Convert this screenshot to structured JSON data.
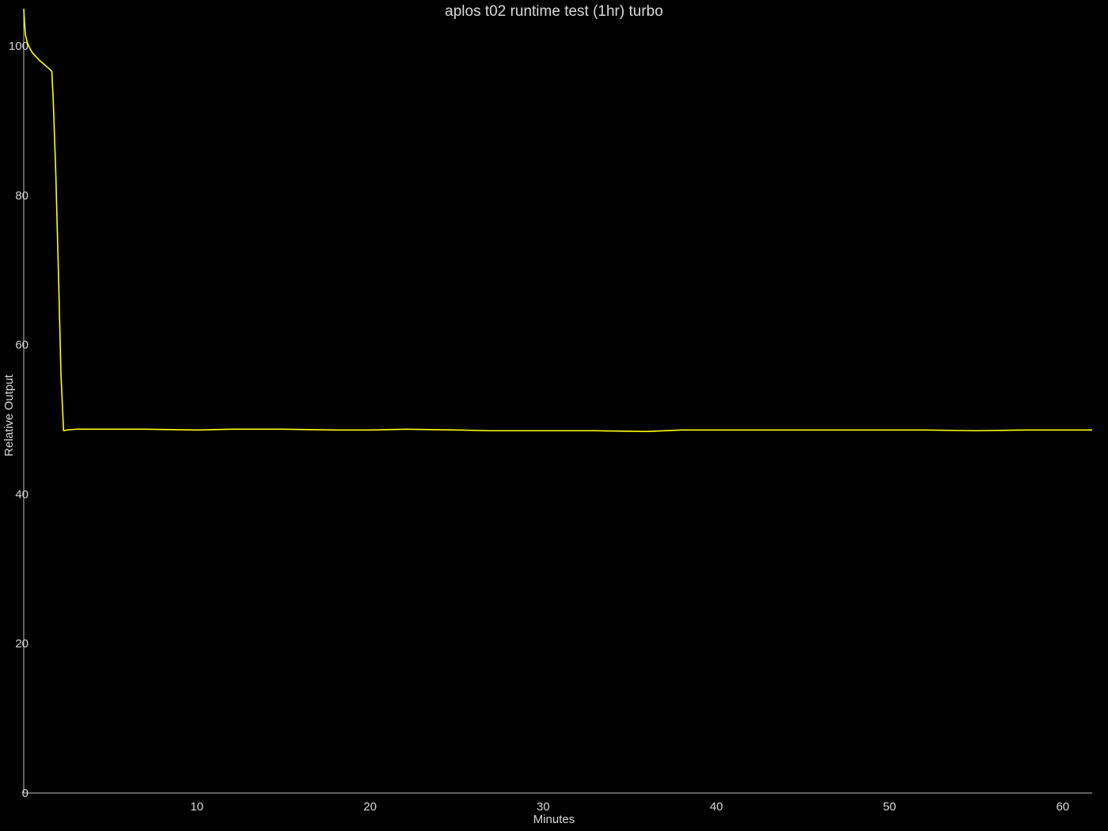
{
  "chart_data": {
    "type": "line",
    "title": "aplos t02 runtime test (1hr) turbo",
    "xlabel": "Minutes",
    "ylabel": "Relative Output",
    "xlim": [
      0,
      61.7
    ],
    "ylim": [
      0,
      105
    ],
    "x_ticks": [
      10,
      20,
      30,
      40,
      50,
      60
    ],
    "y_ticks": [
      0,
      20,
      40,
      60,
      80,
      100
    ],
    "grid": false,
    "legend": "none",
    "colors": {
      "background": "#000000",
      "line": "#ffff00",
      "axis": "#bfbfbf",
      "text": "#d9d9d9"
    },
    "series": [
      {
        "x": [
          0,
          0.05,
          0.1,
          0.2,
          0.35,
          0.5,
          0.7,
          0.9,
          1.1,
          1.3,
          1.5,
          1.62,
          1.7,
          1.85,
          2.0,
          2.15,
          2.3,
          2.5,
          3,
          5,
          7,
          10,
          12,
          15,
          18,
          20,
          22,
          25,
          27,
          30,
          33,
          36,
          38,
          40,
          43,
          46,
          49,
          52,
          55,
          58,
          61.7
        ],
        "y": [
          105,
          103,
          101.5,
          100.5,
          99.7,
          99.1,
          98.6,
          98.1,
          97.7,
          97.3,
          96.9,
          96.6,
          93,
          83,
          70,
          56,
          48.5,
          48.6,
          48.7,
          48.7,
          48.7,
          48.6,
          48.7,
          48.7,
          48.6,
          48.6,
          48.7,
          48.6,
          48.5,
          48.5,
          48.5,
          48.4,
          48.6,
          48.6,
          48.6,
          48.6,
          48.6,
          48.6,
          48.5,
          48.6,
          48.6
        ]
      }
    ]
  }
}
